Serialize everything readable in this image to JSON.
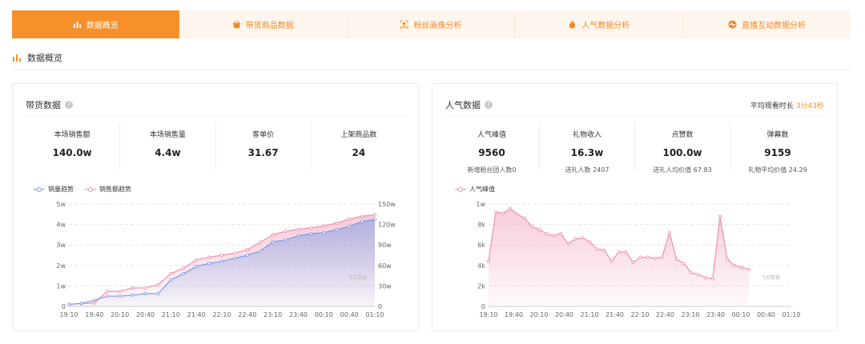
{
  "tabs": [
    {
      "label": "数据概览",
      "icon": "bar-chart-icon",
      "active": true
    },
    {
      "label": "带货商品数据",
      "icon": "shopping-basket-icon",
      "active": false
    },
    {
      "label": "粉丝画像分析",
      "icon": "portrait-scan-icon",
      "active": false
    },
    {
      "label": "人气数据分析",
      "icon": "flame-icon",
      "active": false
    },
    {
      "label": "直播互动数据分析",
      "icon": "pulse-icon",
      "active": false
    }
  ],
  "section": {
    "title": "数据概览",
    "icon": "bar-chart-icon"
  },
  "sales_card": {
    "title": "带货数据",
    "metrics": [
      {
        "label": "本场销售额",
        "value": "140.0w"
      },
      {
        "label": "本场销售量",
        "value": "4.4w"
      },
      {
        "label": "客单价",
        "value": "31.67"
      },
      {
        "label": "上架商品数",
        "value": "24"
      }
    ],
    "watermark": "飞瓜数据"
  },
  "pop_card": {
    "title": "人气数据",
    "avg_watch_label": "平均观看时长",
    "avg_watch_value": "3分43秒",
    "metrics": [
      {
        "label": "人气峰值",
        "value": "9560",
        "sub": "新增粉丝团人数0"
      },
      {
        "label": "礼物收入",
        "value": "16.3w",
        "sub": "送礼人数 2407"
      },
      {
        "label": "点赞数",
        "value": "100.0w",
        "sub": "送礼人均价值 67.83"
      },
      {
        "label": "弹幕数",
        "value": "9159",
        "sub": "礼物平均价值 24.29"
      }
    ],
    "watermark": "飞瓜数据"
  },
  "colors": {
    "accent": "#f7902a",
    "sales_volume": "#7b9be6",
    "sales_amount": "#f08fab",
    "popularity": "#f08fab"
  },
  "chart_data": [
    {
      "type": "line",
      "x": [
        "19:10",
        "19:25",
        "19:40",
        "19:55",
        "20:10",
        "20:25",
        "20:40",
        "20:55",
        "21:10",
        "21:25",
        "21:40",
        "21:55",
        "22:10",
        "22:25",
        "22:40",
        "22:55",
        "23:10",
        "23:25",
        "23:40",
        "23:55",
        "00:10",
        "00:25",
        "00:40",
        "00:55",
        "01:10"
      ],
      "xticks": [
        "19:10",
        "19:40",
        "20:10",
        "20:40",
        "21:10",
        "21:40",
        "22:10",
        "22:40",
        "23:10",
        "23:40",
        "00:10",
        "00:40",
        "01:10"
      ],
      "series": [
        {
          "name": "销量趋势",
          "axis": "left",
          "unit": "w",
          "values": [
            0.1,
            0.15,
            0.3,
            0.5,
            0.5,
            0.55,
            0.62,
            0.62,
            1.3,
            1.6,
            1.95,
            2.1,
            2.2,
            2.35,
            2.5,
            2.7,
            3.15,
            3.25,
            3.45,
            3.55,
            3.6,
            3.75,
            3.9,
            4.15,
            4.25
          ]
        },
        {
          "name": "销售额趋势",
          "axis": "right",
          "unit": "w",
          "values": [
            3,
            4,
            5,
            22,
            22,
            27,
            27,
            32,
            48,
            56,
            68,
            72,
            75,
            78,
            83,
            94,
            105,
            110,
            113,
            115,
            118,
            122,
            128,
            132,
            134
          ]
        }
      ],
      "yticks_left": [
        "0",
        "1w",
        "2w",
        "3w",
        "4w",
        "5w"
      ],
      "yticks_right": [
        "0",
        "30w",
        "60w",
        "90w",
        "120w",
        "150w"
      ],
      "ylim_left": [
        0,
        5
      ],
      "ylim_right": [
        0,
        150
      ]
    },
    {
      "type": "area",
      "x": [
        "19:10",
        "19:15",
        "19:20",
        "19:25",
        "19:30",
        "19:35",
        "19:40",
        "19:45",
        "19:50",
        "19:55",
        "20:00",
        "20:05",
        "20:10",
        "20:15",
        "20:20",
        "20:25",
        "20:30",
        "20:35",
        "20:40",
        "20:45",
        "20:50",
        "20:55",
        "21:00",
        "21:05",
        "21:10",
        "21:15",
        "21:20",
        "21:25",
        "21:30",
        "21:35",
        "21:40",
        "21:45",
        "21:50",
        "21:55",
        "22:00",
        "22:05",
        "22:10",
        "22:15",
        "22:20",
        "22:25",
        "22:30",
        "22:35",
        "22:40",
        "22:45",
        "22:50",
        "22:55",
        "23:00",
        "23:05",
        "23:10",
        "23:15",
        "23:20",
        "23:25",
        "23:30",
        "23:35",
        "23:40",
        "23:45",
        "23:50",
        "23:55",
        "00:00",
        "00:05",
        "00:10",
        "00:15",
        "00:20",
        "00:25",
        "00:30",
        "00:35",
        "00:40",
        "00:45",
        "00:50",
        "00:55",
        "01:00",
        "01:05",
        "01:10"
      ],
      "xticks": [
        "19:10",
        "19:40",
        "20:10",
        "20:40",
        "21:10",
        "21:40",
        "22:10",
        "22:40",
        "23:10",
        "23:40",
        "00:10",
        "00:40",
        "01:10"
      ],
      "series": [
        {
          "name": "人气峰值",
          "values": [
            4400,
            9200,
            9100,
            9560,
            9000,
            8600,
            7800,
            7500,
            7100,
            6900,
            7100,
            6100,
            6600,
            6700,
            6300,
            5600,
            5500,
            4400,
            5300,
            5300,
            4300,
            4800,
            4800,
            4700,
            4800,
            7200,
            4600,
            4200,
            3300,
            3100,
            2800,
            2700,
            8800,
            4600,
            4000,
            3800,
            3600
          ]
        }
      ],
      "yticks": [
        "0",
        "2k",
        "4k",
        "6k",
        "8k",
        "1w"
      ],
      "ylim": [
        0,
        10000
      ]
    }
  ]
}
